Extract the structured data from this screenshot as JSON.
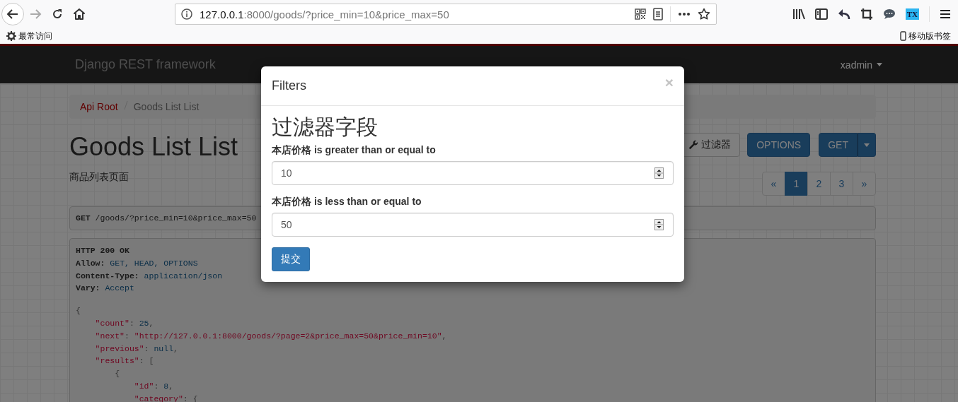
{
  "browser": {
    "url_host": "127.0.0.1",
    "url_rest": ":8000/goods/?price_min=10&price_max=50",
    "extension_badge": "TX",
    "bookmarks": [
      {
        "label": "最常访问"
      }
    ],
    "mobile_bookmarks": "移动版书签"
  },
  "navbar": {
    "brand": "Django REST framework",
    "user": "xadmin"
  },
  "breadcrumbs": [
    {
      "label": "Api Root",
      "kind": "link"
    },
    {
      "label": "Goods List List",
      "kind": "current"
    }
  ],
  "page": {
    "title": "Goods List List",
    "description": "商品列表页面"
  },
  "actions": {
    "filter": "过滤器",
    "options": "OPTIONS",
    "get": "GET"
  },
  "pagination": [
    {
      "label": "«",
      "selected": false
    },
    {
      "label": "1",
      "selected": true
    },
    {
      "label": "2",
      "selected": false
    },
    {
      "label": "3",
      "selected": false
    },
    {
      "label": "»",
      "selected": false
    }
  ],
  "request": {
    "method": "GET",
    "path": "/goods/?price_min=10&price_max=50"
  },
  "response": {
    "status": "HTTP 200 OK",
    "headers": [
      {
        "name": "Allow:",
        "value": "GET, HEAD, OPTIONS"
      },
      {
        "name": "Content-Type:",
        "value": "application/json"
      },
      {
        "name": "Vary:",
        "value": "Accept"
      }
    ],
    "body_lines": [
      [
        {
          "text": "{",
          "kind": "punct"
        }
      ],
      [
        {
          "text": "\"count\"",
          "kind": "key"
        },
        {
          "text": ": ",
          "kind": "punct"
        },
        {
          "text": "25",
          "kind": "literal"
        },
        {
          "text": ",",
          "kind": "punct"
        }
      ],
      [
        {
          "text": "\"next\"",
          "kind": "key"
        },
        {
          "text": ": ",
          "kind": "punct"
        },
        {
          "text": "\"http://127.0.0.1:8000/goods/?page=2&price_max=50&price_min=10\"",
          "kind": "string"
        },
        {
          "text": ",",
          "kind": "punct"
        }
      ],
      [
        {
          "text": "\"previous\"",
          "kind": "key"
        },
        {
          "text": ": ",
          "kind": "punct"
        },
        {
          "text": "null",
          "kind": "literal"
        },
        {
          "text": ",",
          "kind": "punct"
        }
      ],
      [
        {
          "text": "\"results\"",
          "kind": "key"
        },
        {
          "text": ": [",
          "kind": "punct"
        }
      ],
      [
        {
          "text": "{",
          "kind": "punct"
        }
      ],
      [
        {
          "text": "\"id\"",
          "kind": "key"
        },
        {
          "text": ": ",
          "kind": "punct"
        },
        {
          "text": "8",
          "kind": "literal"
        },
        {
          "text": ",",
          "kind": "punct"
        }
      ],
      [
        {
          "text": "\"category\"",
          "kind": "key"
        },
        {
          "text": ": {",
          "kind": "punct"
        }
      ]
    ]
  },
  "modal": {
    "title": "Filters",
    "close": "×",
    "heading": "过滤器字段",
    "fields": [
      {
        "label": "本店价格 is greater than or equal to",
        "value": "10"
      },
      {
        "label": "本店价格 is less than or equal to",
        "value": "50"
      }
    ],
    "submit": "提交"
  }
}
